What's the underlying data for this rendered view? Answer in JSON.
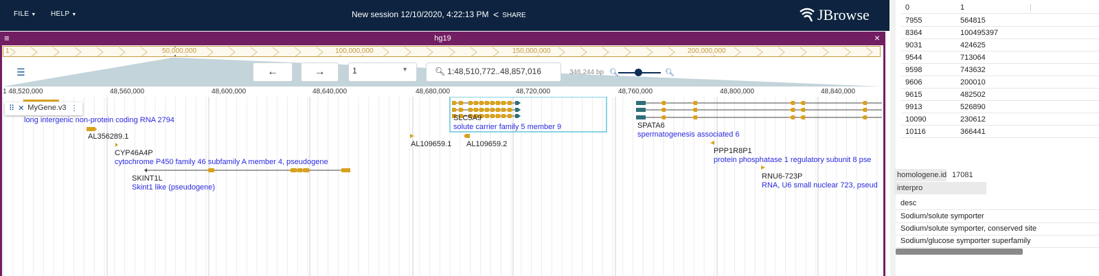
{
  "topbar": {
    "file_label": "FILE",
    "help_label": "HELP",
    "session_title": "New session 12/10/2020, 4:22:13 PM",
    "share_label": "SHARE",
    "logo_text": "JBrowse",
    "bg_color": "#0d233f"
  },
  "view": {
    "assembly": "hg19",
    "header_color": "#721e63",
    "overview_labels": [
      "1",
      "50,000,000",
      "100,000,000",
      "150,000,000",
      "200,000,000"
    ],
    "refname": "1",
    "location": "1:48,510,772..48,857,016",
    "bp_count": "346,244 bp",
    "ruler_labels": [
      "1 48,520,000",
      "48,560,000",
      "48,600,000",
      "48,640,000",
      "48,680,000",
      "48,720,000",
      "48,760,000",
      "48,800,000",
      "48,840,000"
    ]
  },
  "track": {
    "name": "MyGene.v3",
    "feature_color": "#d8a21f",
    "selected_color": "#3bb7d3",
    "features": [
      {
        "desc": "long intergenic non-protein coding RNA 2794"
      },
      {
        "name": "AL356289.1"
      },
      {
        "name": "CYP46A4P",
        "desc": "cytochrome P450 family 46 subfamily A member 4, pseudogene"
      },
      {
        "name": "SKINT1L",
        "desc": "Skint1 like (pseudogene)"
      },
      {
        "name": "AL109659.1"
      },
      {
        "name": "AL109659.2"
      },
      {
        "name": "SLC5A9",
        "desc": "solute carrier family 5 member 9"
      },
      {
        "name": "SPATA6",
        "desc": "spermatogenesis associated 6"
      },
      {
        "name": "PPP1R8P1",
        "desc": "protein phosphatase 1 regulatory subunit 8 pse"
      },
      {
        "name": "RNU6-723P",
        "desc": "RNA, U6 small nuclear 723, pseud"
      }
    ]
  },
  "panel": {
    "table_header": [
      "0",
      "1"
    ],
    "table_rows": [
      [
        "7955",
        "564815"
      ],
      [
        "8364",
        "100495397"
      ],
      [
        "9031",
        "424625"
      ],
      [
        "9544",
        "713064"
      ],
      [
        "9598",
        "743632"
      ],
      [
        "9606",
        "200010"
      ],
      [
        "9615",
        "482502"
      ],
      [
        "9913",
        "526890"
      ],
      [
        "10090",
        "230612"
      ],
      [
        "10116",
        "366441"
      ]
    ],
    "homologene_label": "homologene.id",
    "homologene_value": "17081",
    "interpro_label": "interpro",
    "desc_header": "desc",
    "desc_rows": [
      "Sodium/solute symporter",
      "Sodium/solute symporter, conserved site",
      "Sodium/glucose symporter superfamily"
    ]
  }
}
